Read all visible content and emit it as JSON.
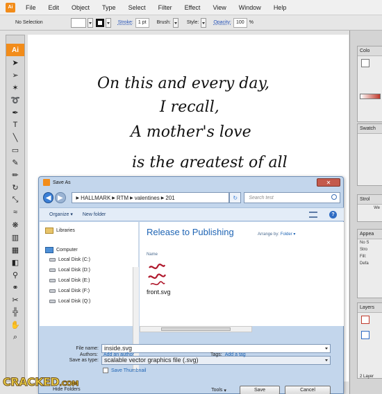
{
  "menubar": {
    "logo": "Ai",
    "items": [
      "File",
      "Edit",
      "Object",
      "Type",
      "Select",
      "Filter",
      "Effect",
      "View",
      "Window",
      "Help"
    ]
  },
  "controlbar": {
    "selection": "No Selection",
    "stroke_label": "Stroke:",
    "stroke_weight": "1 pt",
    "brush_label": "Brush:",
    "style_label": "Style:",
    "opacity_label": "Opacity:",
    "opacity_value": "100",
    "percent": "%"
  },
  "tools": {
    "logo": "Ai"
  },
  "canvas": {
    "line1": "On this and every day,",
    "line2": "I recall,",
    "line3": "A mother's love",
    "line4": "is the greatest of all"
  },
  "right_panels": {
    "color": "Colo",
    "swatches": "Swatch",
    "stroke": "Strol",
    "stroke_weight": "We",
    "appearance": "Appea",
    "appearance_no": "No S",
    "appearance_stroke": "Stro",
    "appearance_fill": "Fill:",
    "appearance_default": "Defa",
    "layers": "Layers",
    "layers_count": "2 Layer"
  },
  "dialog": {
    "title": "Save As",
    "breadcrumb": [
      "HALLMARK",
      "RTM",
      "valentines",
      "201"
    ],
    "search_placeholder": "Search test",
    "organize": "Organize",
    "new_folder": "New folder",
    "nav": {
      "libraries": "Libraries",
      "computer": "Computer",
      "drives": [
        "Local Disk (C:)",
        "Local Disk (D:)",
        "Local Disk (E:)",
        "Local Disk (F:)",
        "Local Disk (Q:)"
      ]
    },
    "library_title": "Release to Publishing",
    "arrange_label": "Arrange by:",
    "arrange_value": "Folder",
    "column_name": "Name",
    "file_thumb_text": "Hpy Vday",
    "file_name": "front.svg",
    "filename_label": "File name:",
    "filename_value": "inside.svg",
    "savetype_label": "Save as type:",
    "savetype_value": "scalable vector graphics file (.svg)",
    "authors_label": "Authors:",
    "authors_value": "Add an author",
    "tags_label": "Tags:",
    "tags_value": "Add a tag",
    "thumbnail_label": "Save Thumbnail",
    "hide_folders": "Hide Folders",
    "tools": "Tools",
    "save": "Save",
    "cancel": "Cancel"
  },
  "watermark": {
    "main": "CRACKED",
    "suffix": ".COM"
  },
  "colors": {
    "ai_orange": "#f28c1a",
    "link_blue": "#1e64b4"
  }
}
